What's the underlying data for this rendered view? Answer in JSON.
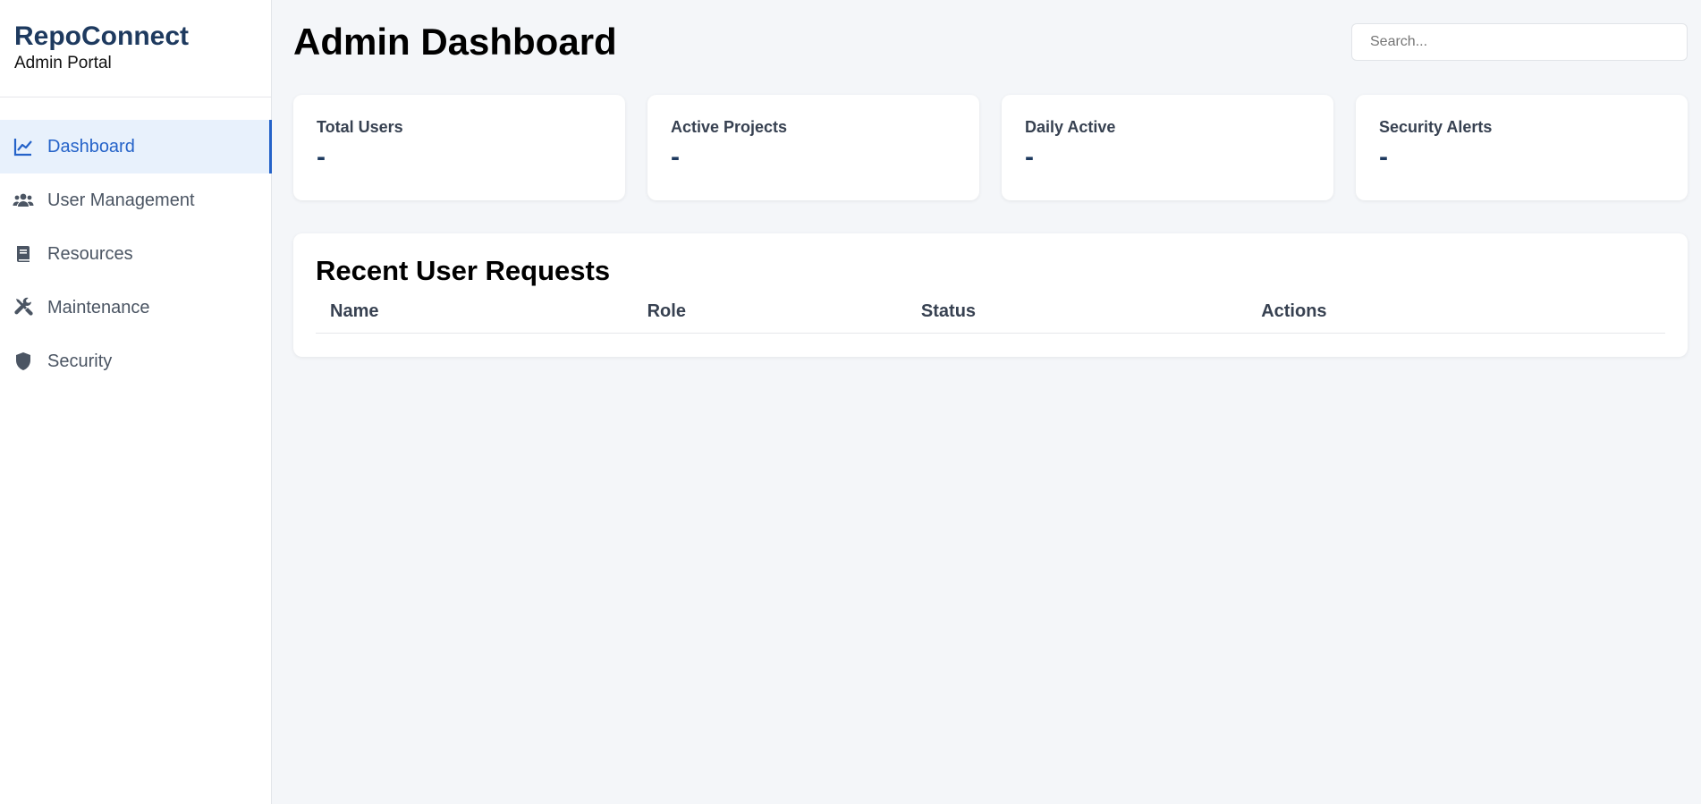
{
  "sidebar": {
    "brand_title": "RepoConnect",
    "brand_subtitle": "Admin Portal",
    "items": [
      {
        "label": "Dashboard",
        "icon": "chart-line-icon",
        "active": true
      },
      {
        "label": "User Management",
        "icon": "users-icon",
        "active": false
      },
      {
        "label": "Resources",
        "icon": "book-icon",
        "active": false
      },
      {
        "label": "Maintenance",
        "icon": "tools-icon",
        "active": false
      },
      {
        "label": "Security",
        "icon": "shield-icon",
        "active": false
      }
    ]
  },
  "header": {
    "title": "Admin Dashboard",
    "search_placeholder": "Search..."
  },
  "stats": [
    {
      "label": "Total Users",
      "value": "-"
    },
    {
      "label": "Active Projects",
      "value": "-"
    },
    {
      "label": "Daily Active",
      "value": "-"
    },
    {
      "label": "Security Alerts",
      "value": "-"
    }
  ],
  "requests": {
    "title": "Recent User Requests",
    "columns": [
      "Name",
      "Role",
      "Status",
      "Actions"
    ],
    "rows": []
  },
  "colors": {
    "accent": "#2563c9",
    "brand": "#1e3a5f",
    "active_bg": "#e8f1fc",
    "background": "#f4f6f9"
  }
}
